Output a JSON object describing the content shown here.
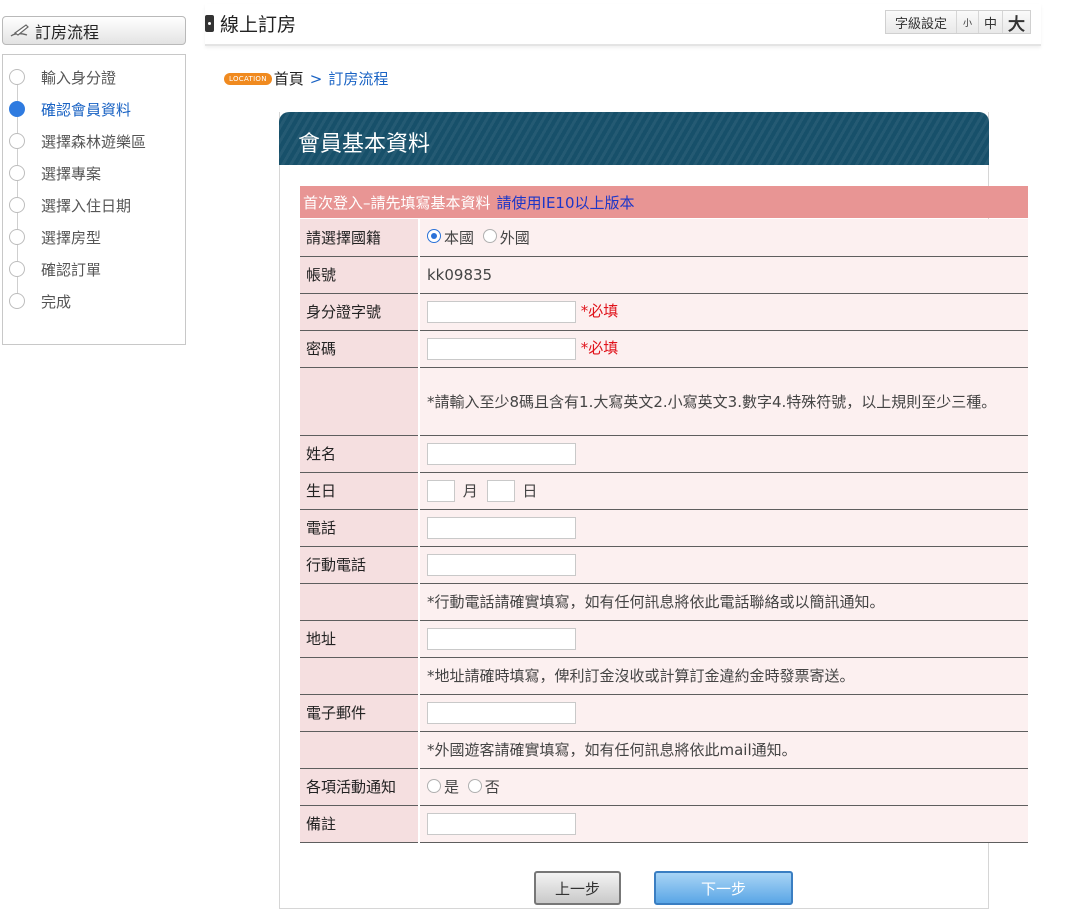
{
  "sidebar": {
    "title": "訂房流程",
    "steps": [
      {
        "label": "輸入身分證",
        "active": false
      },
      {
        "label": "確認會員資料",
        "active": true
      },
      {
        "label": "選擇森林遊樂區",
        "active": false
      },
      {
        "label": "選擇專案",
        "active": false
      },
      {
        "label": "選擇入住日期",
        "active": false
      },
      {
        "label": "選擇房型",
        "active": false
      },
      {
        "label": "確認訂單",
        "active": false
      },
      {
        "label": "完成",
        "active": false
      }
    ]
  },
  "header": {
    "title": "線上訂房",
    "font_size": {
      "label": "字級設定",
      "small": "小",
      "medium": "中",
      "large": "大"
    }
  },
  "breadcrumb": {
    "badge": "LOCATION",
    "home": "首頁",
    "separator": ">",
    "current": "訂房流程"
  },
  "form": {
    "title": "會員基本資料",
    "banner": "首次登入–請先填寫基本資料",
    "banner_hint": "請使用IE10以上版本",
    "nationality": {
      "label": "請選擇國籍",
      "options": [
        "本國",
        "外國"
      ],
      "selected": "本國"
    },
    "account": {
      "label": "帳號",
      "value": "kk09835"
    },
    "id_number": {
      "label": "身分證字號",
      "value": "",
      "required": "*必填"
    },
    "password": {
      "label": "密碼",
      "value": "",
      "required": "*必填"
    },
    "password_rule": "*請輸入至少8碼且含有1.大寫英文2.小寫英文3.數字4.特殊符號，以上規則至少三種。",
    "name": {
      "label": "姓名",
      "value": ""
    },
    "birthday": {
      "label": "生日",
      "month_unit": "月",
      "day_unit": "日",
      "month": "",
      "day": ""
    },
    "phone": {
      "label": "電話",
      "value": ""
    },
    "mobile": {
      "label": "行動電話",
      "value": ""
    },
    "mobile_note": "*行動電話請確實填寫，如有任何訊息將依此電話聯絡或以簡訊通知。",
    "address": {
      "label": "地址",
      "value": ""
    },
    "address_note": "*地址請確時填寫，俾利訂金沒收或計算訂金違約金時發票寄送。",
    "email": {
      "label": "電子郵件",
      "value": ""
    },
    "email_note": "*外國遊客請確實填寫，如有任何訊息將依此mail通知。",
    "notify": {
      "label": "各項活動通知",
      "options": [
        "是",
        "否"
      ],
      "selected": ""
    },
    "remarks": {
      "label": "備註",
      "value": ""
    }
  },
  "buttons": {
    "prev": "上一步",
    "next": "下一步"
  },
  "colors": {
    "banner": "#e89594",
    "label_bg": "#f5dfe0",
    "value_bg": "#fcf0f0",
    "required": "#e0131b",
    "panel_head": "#17506a",
    "link": "#1a63c4"
  }
}
